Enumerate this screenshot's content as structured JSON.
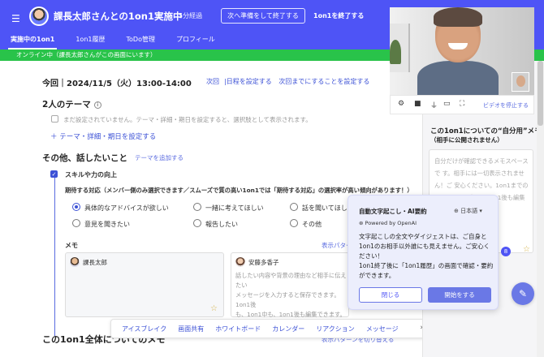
{
  "header": {
    "title": "課長太郎さんとの1on1実施中",
    "elapsed": "5分経過",
    "prepare_next_button": "次へ準備をして終了する",
    "end_button": "1on1を終了する",
    "tabs": [
      {
        "label": "実施中の1on1",
        "active": true
      },
      {
        "label": "1on1履歴",
        "active": false
      },
      {
        "label": "ToDo管理",
        "active": false
      },
      {
        "label": "プロフィール",
        "active": false
      }
    ]
  },
  "status_bar": "オンライン中（課長太郎さんがこの画面にいます）",
  "session": {
    "today_label": "今回",
    "date_time": "2024/11/5（火）13:00-14:00",
    "links": [
      "次回",
      "日程を設定する",
      "次回までにすることを設定する"
    ]
  },
  "theme_section": {
    "title": "2人のテーマ",
    "placeholder": "まだ設定されていません。テーマ・詳細・期日を設定すると、選択肢として表示されます。",
    "add_link": "＋  テーマ・詳細・期日を設定する"
  },
  "other_section": {
    "title": "その他、話したいこと",
    "add_link": "テーマを追加する",
    "item_title": "スキルや力の向上",
    "expectation": "期待する対応（メンバー側のみ選択できます／スムーズで質の高い1on1では「期待する対応」の選択率が高い傾向があります！）",
    "options": [
      {
        "label": "具体的なアドバイスが欲しい",
        "selected": true
      },
      {
        "label": "一緒に考えてほしい",
        "selected": false
      },
      {
        "label": "話を聞いてほしい",
        "selected": false
      },
      {
        "label": "意見を聞きたい",
        "selected": false
      },
      {
        "label": "報告したい",
        "selected": false
      },
      {
        "label": "その他",
        "selected": false
      }
    ],
    "memo_label": "メモ",
    "show_pattern": "表示パターン",
    "memo_author_1": "課長太郎",
    "memo_author_2": "安藤多香子",
    "memo_placeholder_2": "話したい内容や背景の理由など相手に伝えたい\nメッセージを入力すると保存できます。1on1後\nも、1on1中も、1on1後も編集できます。"
  },
  "bottom_section": {
    "title": "この1on1全体についてのメモ",
    "show_pattern": "表示パターンを切り替える"
  },
  "toolbar": {
    "items": [
      "アイスブレイク",
      "画面共有",
      "ホワイトボード",
      "カレンダー",
      "リアクション",
      "メッセージ"
    ],
    "more": "›"
  },
  "video": {
    "stop_label": "ビデオを停止する"
  },
  "personal_memo": {
    "title": "この1on1についての“自分用”メモ",
    "subtitle": "（相手に公開されません）",
    "placeholder": "自分だけが確認できるメモスペースで す。相手には一切表示されません！ご 安心ください。1on1までの間も、 1on1中も、1on1後も編集できます。",
    "badge": "8"
  },
  "popup": {
    "title": "自動文字起こし・AI要約",
    "language": "日本語",
    "powered": "Powered by OpenAI",
    "body": "文字起こしの全文やダイジェストは、ご自身と1on1のお相手以外誰にも見えません。ご安心ください！\n1on1終了後に「1on1履歴」の画面で確認・要約ができます。",
    "close_button": "閉じる",
    "start_button": "開始をする"
  },
  "colors": {
    "brand": "#4e54f6",
    "online": "#29c34a",
    "link": "#3d52d6"
  }
}
